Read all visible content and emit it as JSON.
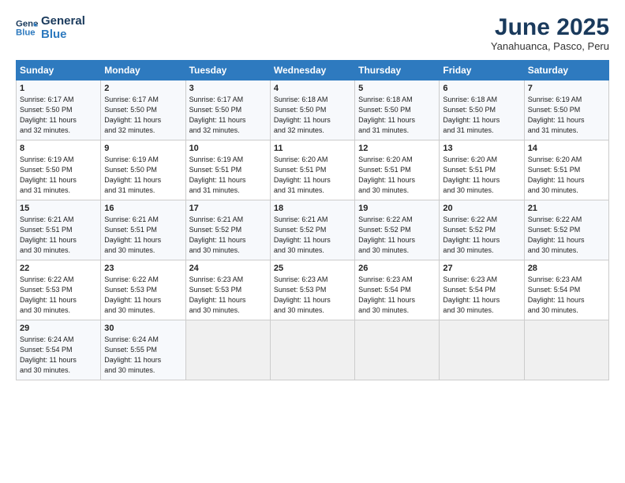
{
  "logo": {
    "line1": "General",
    "line2": "Blue"
  },
  "title": "June 2025",
  "location": "Yanahuanca, Pasco, Peru",
  "days_of_week": [
    "Sunday",
    "Monday",
    "Tuesday",
    "Wednesday",
    "Thursday",
    "Friday",
    "Saturday"
  ],
  "weeks": [
    [
      {
        "day": "1",
        "info": "Sunrise: 6:17 AM\nSunset: 5:50 PM\nDaylight: 11 hours\nand 32 minutes."
      },
      {
        "day": "2",
        "info": "Sunrise: 6:17 AM\nSunset: 5:50 PM\nDaylight: 11 hours\nand 32 minutes."
      },
      {
        "day": "3",
        "info": "Sunrise: 6:17 AM\nSunset: 5:50 PM\nDaylight: 11 hours\nand 32 minutes."
      },
      {
        "day": "4",
        "info": "Sunrise: 6:18 AM\nSunset: 5:50 PM\nDaylight: 11 hours\nand 32 minutes."
      },
      {
        "day": "5",
        "info": "Sunrise: 6:18 AM\nSunset: 5:50 PM\nDaylight: 11 hours\nand 31 minutes."
      },
      {
        "day": "6",
        "info": "Sunrise: 6:18 AM\nSunset: 5:50 PM\nDaylight: 11 hours\nand 31 minutes."
      },
      {
        "day": "7",
        "info": "Sunrise: 6:19 AM\nSunset: 5:50 PM\nDaylight: 11 hours\nand 31 minutes."
      }
    ],
    [
      {
        "day": "8",
        "info": "Sunrise: 6:19 AM\nSunset: 5:50 PM\nDaylight: 11 hours\nand 31 minutes."
      },
      {
        "day": "9",
        "info": "Sunrise: 6:19 AM\nSunset: 5:50 PM\nDaylight: 11 hours\nand 31 minutes."
      },
      {
        "day": "10",
        "info": "Sunrise: 6:19 AM\nSunset: 5:51 PM\nDaylight: 11 hours\nand 31 minutes."
      },
      {
        "day": "11",
        "info": "Sunrise: 6:20 AM\nSunset: 5:51 PM\nDaylight: 11 hours\nand 31 minutes."
      },
      {
        "day": "12",
        "info": "Sunrise: 6:20 AM\nSunset: 5:51 PM\nDaylight: 11 hours\nand 30 minutes."
      },
      {
        "day": "13",
        "info": "Sunrise: 6:20 AM\nSunset: 5:51 PM\nDaylight: 11 hours\nand 30 minutes."
      },
      {
        "day": "14",
        "info": "Sunrise: 6:20 AM\nSunset: 5:51 PM\nDaylight: 11 hours\nand 30 minutes."
      }
    ],
    [
      {
        "day": "15",
        "info": "Sunrise: 6:21 AM\nSunset: 5:51 PM\nDaylight: 11 hours\nand 30 minutes."
      },
      {
        "day": "16",
        "info": "Sunrise: 6:21 AM\nSunset: 5:51 PM\nDaylight: 11 hours\nand 30 minutes."
      },
      {
        "day": "17",
        "info": "Sunrise: 6:21 AM\nSunset: 5:52 PM\nDaylight: 11 hours\nand 30 minutes."
      },
      {
        "day": "18",
        "info": "Sunrise: 6:21 AM\nSunset: 5:52 PM\nDaylight: 11 hours\nand 30 minutes."
      },
      {
        "day": "19",
        "info": "Sunrise: 6:22 AM\nSunset: 5:52 PM\nDaylight: 11 hours\nand 30 minutes."
      },
      {
        "day": "20",
        "info": "Sunrise: 6:22 AM\nSunset: 5:52 PM\nDaylight: 11 hours\nand 30 minutes."
      },
      {
        "day": "21",
        "info": "Sunrise: 6:22 AM\nSunset: 5:52 PM\nDaylight: 11 hours\nand 30 minutes."
      }
    ],
    [
      {
        "day": "22",
        "info": "Sunrise: 6:22 AM\nSunset: 5:53 PM\nDaylight: 11 hours\nand 30 minutes."
      },
      {
        "day": "23",
        "info": "Sunrise: 6:22 AM\nSunset: 5:53 PM\nDaylight: 11 hours\nand 30 minutes."
      },
      {
        "day": "24",
        "info": "Sunrise: 6:23 AM\nSunset: 5:53 PM\nDaylight: 11 hours\nand 30 minutes."
      },
      {
        "day": "25",
        "info": "Sunrise: 6:23 AM\nSunset: 5:53 PM\nDaylight: 11 hours\nand 30 minutes."
      },
      {
        "day": "26",
        "info": "Sunrise: 6:23 AM\nSunset: 5:54 PM\nDaylight: 11 hours\nand 30 minutes."
      },
      {
        "day": "27",
        "info": "Sunrise: 6:23 AM\nSunset: 5:54 PM\nDaylight: 11 hours\nand 30 minutes."
      },
      {
        "day": "28",
        "info": "Sunrise: 6:23 AM\nSunset: 5:54 PM\nDaylight: 11 hours\nand 30 minutes."
      }
    ],
    [
      {
        "day": "29",
        "info": "Sunrise: 6:24 AM\nSunset: 5:54 PM\nDaylight: 11 hours\nand 30 minutes."
      },
      {
        "day": "30",
        "info": "Sunrise: 6:24 AM\nSunset: 5:55 PM\nDaylight: 11 hours\nand 30 minutes."
      },
      {
        "day": "",
        "info": ""
      },
      {
        "day": "",
        "info": ""
      },
      {
        "day": "",
        "info": ""
      },
      {
        "day": "",
        "info": ""
      },
      {
        "day": "",
        "info": ""
      }
    ]
  ]
}
